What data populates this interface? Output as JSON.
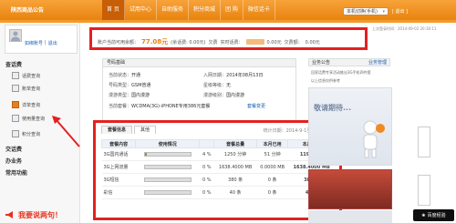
{
  "brand": "陕西商品公告",
  "nav": [
    "首 页",
    "试用中心",
    "自助服务",
    "积分商城",
    "团 购",
    "微信话卡"
  ],
  "user_select": "本机切换(手机)",
  "logout_link": "[ 退出 ]",
  "profile": {
    "phone": "如绑账号",
    "sep": "|",
    "logout": "退出"
  },
  "sidebar": {
    "section_title": "查话费",
    "items": [
      "话费查询",
      "账单查询",
      "详单查询",
      "使用量查询",
      "积分查询"
    ],
    "categories": [
      "交话费",
      "办业务",
      "常用功能"
    ],
    "feedback": "我要说两句！"
  },
  "balance": {
    "label_1": "账户当前可用余额：",
    "amount_1": "77.08元",
    "label_2": "(余话费: 0.00元)",
    "label_3": "欠费",
    "label_4": "实时话费：",
    "amount_2": "0.00元",
    "label_5": "欠费额：",
    "amount_3": "0.00元"
  },
  "notice_right": "上次登录时间：2014-09-02 20:30:11",
  "info_panel": {
    "header": "号码基础",
    "rows": [
      {
        "k": "当前状态：",
        "v": "开通"
      },
      {
        "k": "入网日期：",
        "v": "2014年08月13日"
      },
      {
        "k": "号码类型：",
        "v": "GSM普通"
      },
      {
        "k": "星级等级：",
        "v": "无"
      },
      {
        "k": "漫游类型：",
        "v": "国内漫游"
      },
      {
        "k": "漫游级别：",
        "v": "国内漫游"
      },
      {
        "k": "当前套餐：",
        "v": "WCDMA(3G)-iPHONE专用386元套餐"
      },
      {
        "k": "套餐变更",
        "v": ""
      }
    ]
  },
  "usage": {
    "tabs": [
      "套餐信息",
      "其他"
    ],
    "period": "统计日期：2014-9-1至2014-9-2",
    "headers": [
      "套餐内容",
      "使用情况",
      "",
      "套餐总量",
      "本月已用",
      "本月剩余"
    ],
    "rows": [
      {
        "name": "3G国内通话",
        "pct": "4 %",
        "pct_num": 0.04,
        "total": "1250 分钟",
        "used": "51 分钟",
        "left": "1199 分钟"
      },
      {
        "name": "3G上网流量",
        "pct": "0 %",
        "pct_num": 0.0,
        "total": "1638.4000 MB",
        "used": "0.0000 MB",
        "left": "1638.4000 MB"
      },
      {
        "name": "3G短信",
        "pct": "0 %",
        "pct_num": 0.0,
        "total": "380 条",
        "used": "0 条",
        "left": "380 条"
      },
      {
        "name": "彩信",
        "pct": "0 %",
        "pct_num": 0.0,
        "total": "40 条",
        "used": "0 条",
        "left": "40 条"
      }
    ]
  },
  "right_panel": {
    "title": "业务公告",
    "more": "业务管理",
    "text_1": "回家话费专享活动推出3G手机四件套",
    "text_2": "以上信息仅供参考",
    "banner_title": "敬请期待..."
  },
  "baidu": "百度经验",
  "colors": {
    "accent": "#e8830e",
    "highlight": "#e52020",
    "link": "#1a5fae"
  }
}
